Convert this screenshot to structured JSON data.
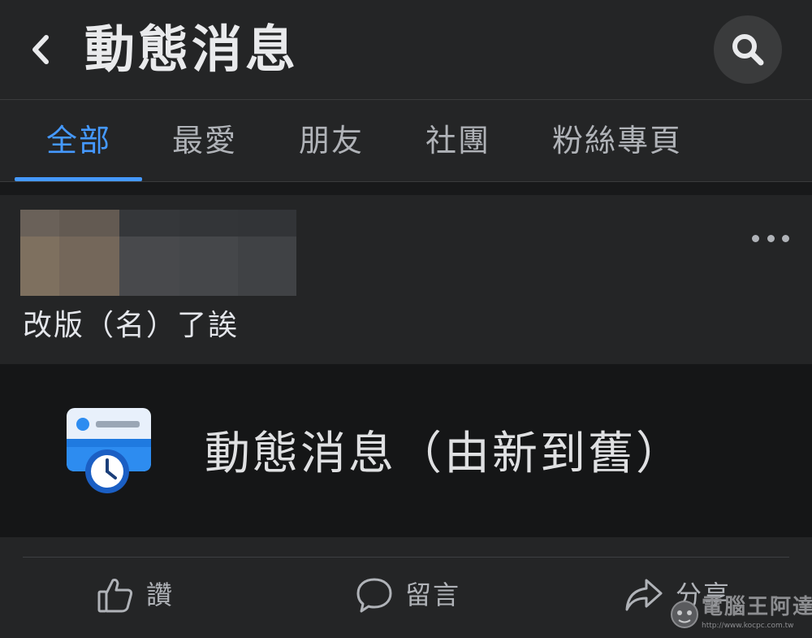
{
  "header": {
    "title": "動態消息"
  },
  "tabs": [
    {
      "label": "全部",
      "active": true
    },
    {
      "label": "最愛",
      "active": false
    },
    {
      "label": "朋友",
      "active": false
    },
    {
      "label": "社團",
      "active": false
    },
    {
      "label": "粉絲專頁",
      "active": false
    }
  ],
  "post": {
    "text": "改版（名）了誒",
    "feature_label": "動態消息（由新到舊）"
  },
  "actions": {
    "like_label": "讚",
    "comment_label": "留言",
    "share_label": "分享"
  },
  "watermark": {
    "text": "電腦王阿達",
    "url": "http://www.kocpc.com.tw"
  },
  "colors": {
    "accent": "#4599ff",
    "background": "#18191a",
    "surface": "#242526"
  },
  "icons": {
    "back": "chevron-left-icon",
    "search": "search-icon",
    "more": "more-horizontal-icon",
    "feature": "feed-clock-icon",
    "like": "thumbs-up-icon",
    "comment": "comment-bubble-icon",
    "share": "share-arrow-icon"
  }
}
